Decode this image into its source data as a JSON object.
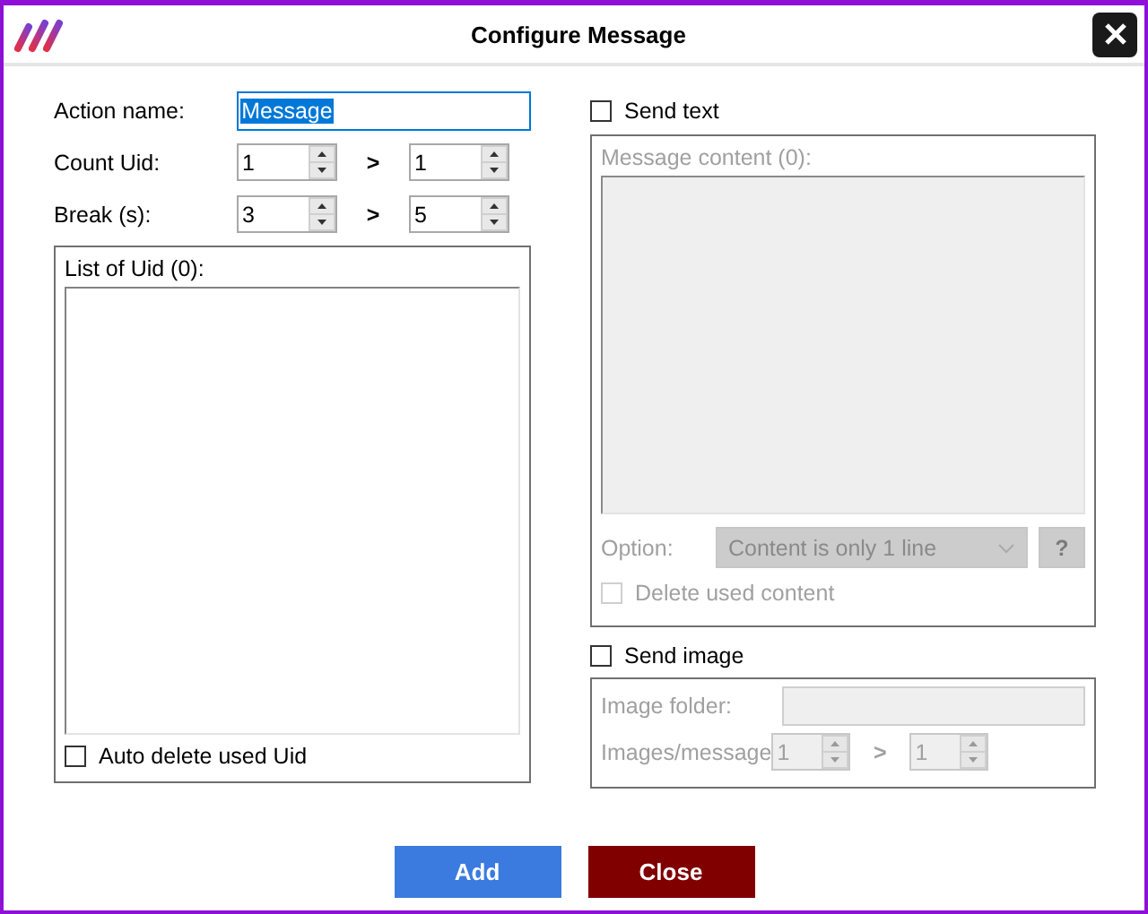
{
  "window": {
    "title": "Configure Message"
  },
  "action_name": {
    "label": "Action name:",
    "value": "Message",
    "text_selected": true
  },
  "count_uid": {
    "label": "Count Uid:",
    "from": "1",
    "separator": ">",
    "to": "1"
  },
  "break": {
    "label": "Break (s):",
    "from": "3",
    "separator": ">",
    "to": "5"
  },
  "uid_list": {
    "label": "List of Uid (0):",
    "auto_delete": {
      "label": "Auto delete used Uid",
      "checked": false
    }
  },
  "send_text": {
    "label": "Send text",
    "checked": false,
    "content_label": "Message content (0):",
    "option_label": "Option:",
    "option_value": "Content is only 1 line",
    "help": "?",
    "delete_used": {
      "label": "Delete used content",
      "checked": false
    }
  },
  "send_image": {
    "label": "Send image",
    "checked": false,
    "folder_label": "Image folder:",
    "per_message_label": "Images/message",
    "from": "1",
    "separator": ">",
    "to": "1"
  },
  "buttons": [
    {
      "label": "Add",
      "kind": "primary"
    },
    {
      "label": "Close",
      "kind": "danger"
    }
  ]
}
